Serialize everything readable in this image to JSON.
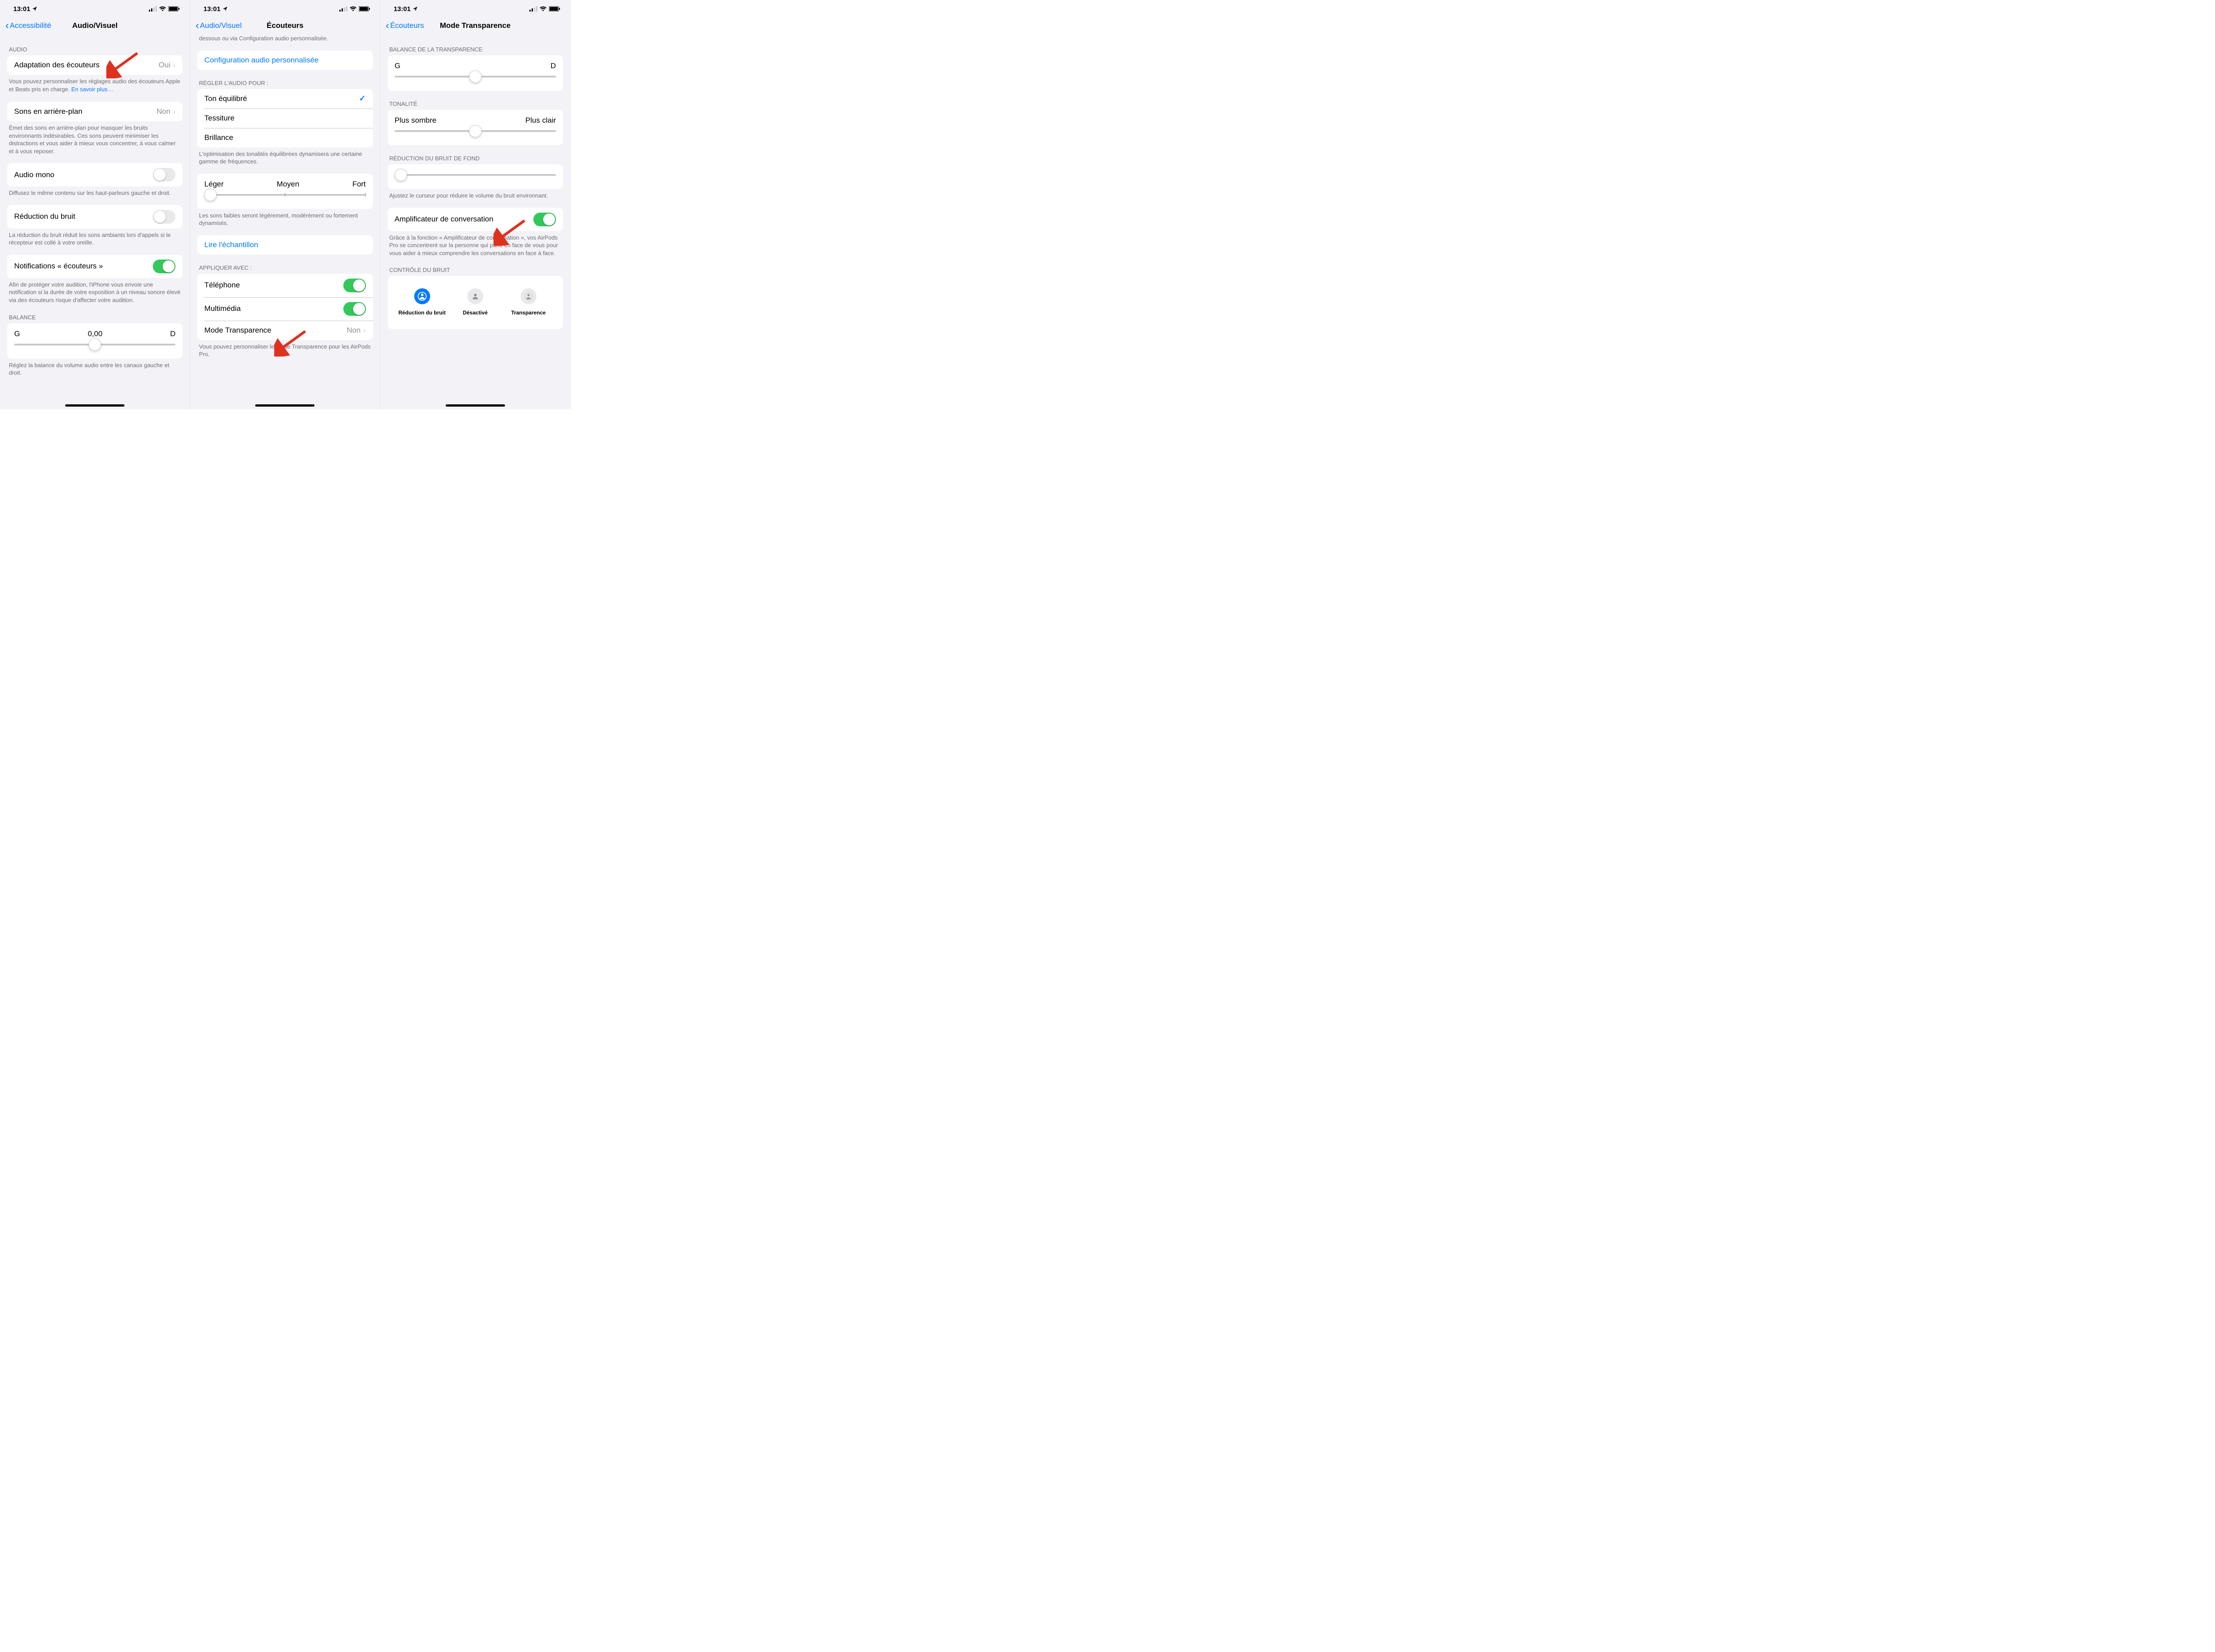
{
  "status": {
    "time": "13:01"
  },
  "screen1": {
    "back": "Accessibilité",
    "title": "Audio/Visuel",
    "header_audio": "AUDIO",
    "row_adaptation_label": "Adaptation des écouteurs",
    "row_adaptation_value": "Oui",
    "footer_adaptation": "Vous pouvez personnaliser les réglages audio des écouteurs Apple et Beats pris en charge. ",
    "footer_adaptation_link": "En savoir plus…",
    "row_background_label": "Sons en arrière-plan",
    "row_background_value": "Non",
    "footer_background": "Émet des sons en arrière-plan pour masquer les bruits environnants indésirables. Ces sons peuvent minimiser les distractions et vous aider à mieux vous concentrer, à vous calmer et à vous reposer.",
    "row_mono_label": "Audio mono",
    "footer_mono": "Diffusez le même contenu sur les haut-parleurs gauche et droit.",
    "row_noise_label": "Réduction du bruit",
    "footer_noise": "La réduction du bruit réduit les sons ambiants lors d'appels si le récepteur est collé à votre oreille.",
    "row_notif_label": "Notifications « écouteurs »",
    "footer_notif": "Afin de protéger votre audition, l'iPhone vous envoie une notification si la durée de votre exposition à un niveau sonore élevé via des écouteurs risque d'affecter votre audition.",
    "header_balance": "BALANCE",
    "balance_left": "G",
    "balance_center": "0,00",
    "balance_right": "D",
    "footer_balance": "Réglez la balance du volume audio entre les canaux gauche et droit."
  },
  "screen2": {
    "back": "Audio/Visuel",
    "title": "Écouteurs",
    "truncated_text": "dessous ou via Configuration audio personnalisée.",
    "link_config": "Configuration audio personnalisée",
    "header_tune": "RÉGLER L'AUDIO POUR :",
    "opt_balanced": "Ton équilibré",
    "opt_range": "Tessiture",
    "opt_brightness": "Brillance",
    "footer_tune": "L'optimisation des tonalités équilibrées dynamisera une certaine gamme de fréquences.",
    "slider_light": "Léger",
    "slider_medium": "Moyen",
    "slider_strong": "Fort",
    "footer_slider": "Les sons faibles seront légèrement, modérément ou fortement dynamisés.",
    "link_sample": "Lire l'échantillon",
    "header_apply": "APPLIQUER AVEC :",
    "row_phone": "Téléphone",
    "row_media": "Multimédia",
    "row_transparency_label": "Mode Transparence",
    "row_transparency_value": "Non",
    "footer_apply": "Vous pouvez personnaliser le mode Transparence pour les AirPods Pro."
  },
  "screen3": {
    "back": "Écouteurs",
    "title": "Mode Transparence",
    "header_balance": "BALANCE DE LA TRANSPARENCE",
    "balance_left": "G",
    "balance_right": "D",
    "header_tone": "TONALITÉ",
    "tone_dark": "Plus sombre",
    "tone_light": "Plus clair",
    "header_noise": "RÉDUCTION DU BRUIT DE FOND",
    "footer_noise": "Ajustez le curseur pour réduire le volume du bruit environnant.",
    "row_amp_label": "Amplificateur de conversation",
    "footer_amp": "Grâce à la fonction « Amplificateur de conversation », vos AirPods Pro se concentrent sur la personne qui parle en face de vous pour vous aider à mieux comprendre les conversations en face à face.",
    "header_control": "CONTRÔLE DU BRUIT",
    "seg_noise": "Réduction du bruit",
    "seg_off": "Désactivé",
    "seg_trans": "Transparence"
  }
}
